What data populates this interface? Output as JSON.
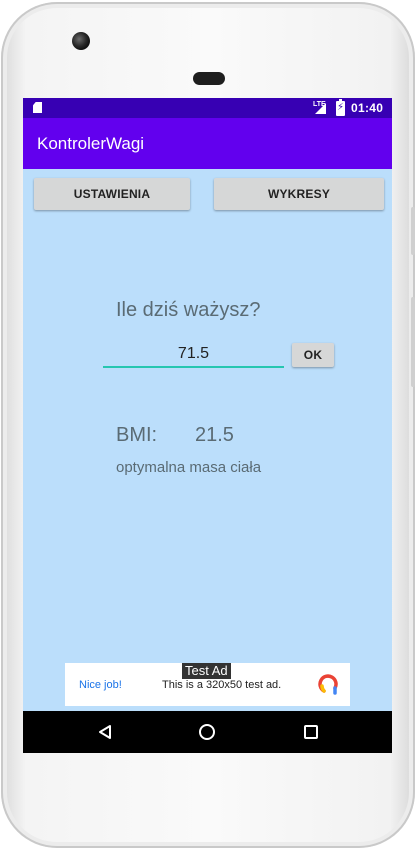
{
  "status_bar": {
    "network_label": "LTE",
    "time": "01:40",
    "icons": [
      "sd-card-icon",
      "signal-icon",
      "battery-charging-icon"
    ]
  },
  "app_bar": {
    "title": "KontrolerWagi",
    "color": "#6200ee",
    "status_color": "#3700b3"
  },
  "buttons": {
    "settings": "USTAWIENIA",
    "charts": "WYKRESY",
    "ok": "OK"
  },
  "weight": {
    "question": "Ile dziś ważysz?",
    "value": "71.5"
  },
  "bmi": {
    "label": "BMI:",
    "value": "21.5",
    "description": "optymalna masa ciała"
  },
  "ad": {
    "tag": "Test Ad",
    "nice": "Nice job!",
    "text": "This is a 320x50 test ad."
  },
  "colors": {
    "background": "#bbdefb",
    "input_underline": "#26c6b0"
  },
  "nav_icons": [
    "back-icon",
    "home-icon",
    "recents-icon"
  ]
}
